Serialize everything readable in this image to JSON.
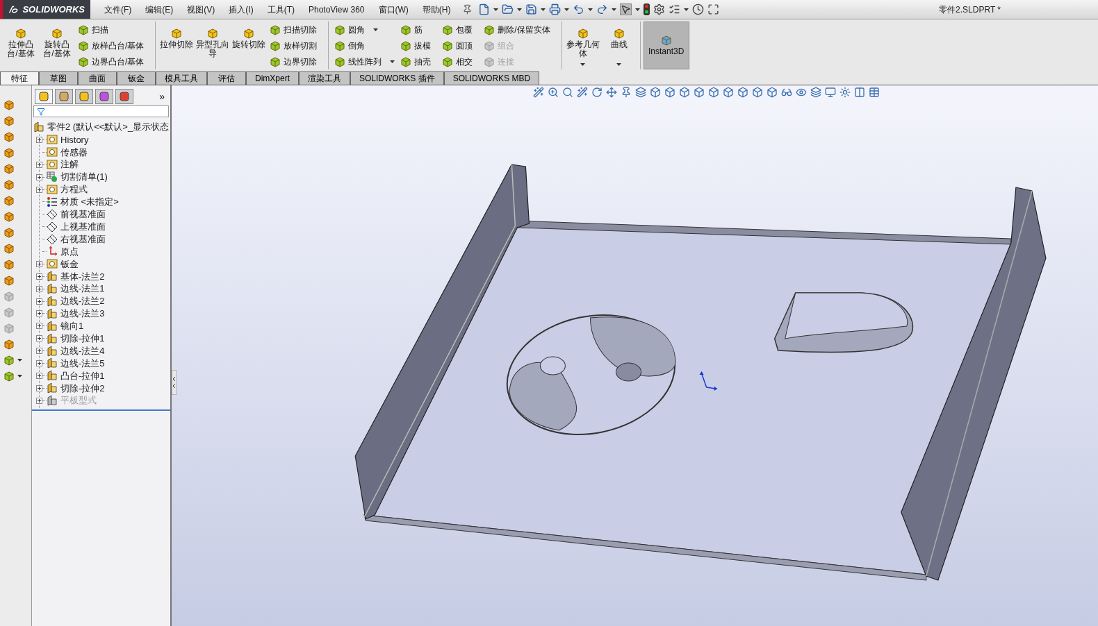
{
  "app": {
    "logo": "SOLIDWORKS",
    "title": "零件2.SLDPRT *"
  },
  "menu": [
    "文件(F)",
    "编辑(E)",
    "视图(V)",
    "插入(I)",
    "工具(T)",
    "PhotoView 360",
    "窗口(W)",
    "帮助(H)"
  ],
  "ribbon": [
    [
      {
        "kind": "large",
        "commands": [
          {
            "label": "拉伸凸台/基体",
            "disabled": false,
            "dropdown": false,
            "selected": false
          }
        ]
      },
      {
        "kind": "large",
        "commands": [
          {
            "label": "旋转凸台/基体",
            "disabled": false,
            "dropdown": false,
            "selected": false
          }
        ]
      },
      {
        "kind": "small",
        "commands": [
          {
            "label": "扫描",
            "disabled": false,
            "dropdown": false,
            "selected": false
          },
          {
            "label": "放样凸台/基体",
            "disabled": false,
            "dropdown": false,
            "selected": false
          },
          {
            "label": "边界凸台/基体",
            "disabled": false,
            "dropdown": false,
            "selected": false
          }
        ]
      }
    ],
    [
      {
        "kind": "large",
        "commands": [
          {
            "label": "拉伸切除",
            "disabled": false,
            "dropdown": false,
            "selected": false
          }
        ]
      },
      {
        "kind": "large",
        "commands": [
          {
            "label": "异型孔向导",
            "disabled": false,
            "dropdown": false,
            "selected": false
          }
        ]
      },
      {
        "kind": "large",
        "commands": [
          {
            "label": "旋转切除",
            "disabled": false,
            "dropdown": false,
            "selected": false
          }
        ]
      },
      {
        "kind": "small",
        "commands": [
          {
            "label": "扫描切除",
            "disabled": false,
            "dropdown": false,
            "selected": false
          },
          {
            "label": "放样切割",
            "disabled": false,
            "dropdown": false,
            "selected": false
          },
          {
            "label": "边界切除",
            "disabled": false,
            "dropdown": false,
            "selected": false
          }
        ]
      }
    ],
    [
      {
        "kind": "small",
        "commands": [
          {
            "label": "圆角",
            "disabled": false,
            "dropdown": true,
            "selected": false
          },
          {
            "label": "倒角",
            "disabled": false,
            "dropdown": false,
            "selected": false
          },
          {
            "label": "线性阵列",
            "disabled": false,
            "dropdown": true,
            "selected": false
          }
        ]
      },
      {
        "kind": "small",
        "commands": [
          {
            "label": "筋",
            "disabled": false,
            "dropdown": false,
            "selected": false
          },
          {
            "label": "拔模",
            "disabled": false,
            "dropdown": false,
            "selected": false
          },
          {
            "label": "抽壳",
            "disabled": false,
            "dropdown": false,
            "selected": false
          }
        ]
      },
      {
        "kind": "small",
        "commands": [
          {
            "label": "包覆",
            "disabled": false,
            "dropdown": false,
            "selected": false
          },
          {
            "label": "圆顶",
            "disabled": false,
            "dropdown": false,
            "selected": false
          },
          {
            "label": "相交",
            "disabled": false,
            "dropdown": false,
            "selected": false
          }
        ]
      },
      {
        "kind": "small",
        "commands": [
          {
            "label": "删除/保留实体",
            "disabled": false,
            "dropdown": false,
            "selected": false
          },
          {
            "label": "组合",
            "disabled": true,
            "dropdown": false,
            "selected": false
          },
          {
            "label": "连接",
            "disabled": true,
            "dropdown": false,
            "selected": false
          }
        ]
      }
    ],
    [
      {
        "kind": "large",
        "commands": [
          {
            "label": "参考几何体",
            "disabled": false,
            "dropdown": true,
            "selected": false
          }
        ]
      },
      {
        "kind": "large",
        "commands": [
          {
            "label": "曲线",
            "disabled": false,
            "dropdown": true,
            "selected": false
          }
        ]
      }
    ],
    [
      {
        "kind": "large",
        "commands": [
          {
            "label": "Instant3D",
            "disabled": false,
            "dropdown": false,
            "selected": true
          }
        ]
      }
    ]
  ],
  "tabs": [
    {
      "label": "特征",
      "selected": true
    },
    {
      "label": "草图",
      "selected": false
    },
    {
      "label": "曲面",
      "selected": false
    },
    {
      "label": "钣金",
      "selected": false
    },
    {
      "label": "模具工具",
      "selected": false
    },
    {
      "label": "评估",
      "selected": false
    },
    {
      "label": "DimXpert",
      "selected": false
    },
    {
      "label": "渲染工具",
      "selected": false
    },
    {
      "label": "SOLIDWORKS 插件",
      "selected": false
    },
    {
      "label": "SOLIDWORKS MBD",
      "selected": false
    }
  ],
  "tree": {
    "panel_tabs": [
      {
        "selected": true
      },
      {
        "selected": false
      },
      {
        "selected": false
      },
      {
        "selected": false
      },
      {
        "selected": false
      }
    ],
    "more": "»",
    "root": "零件2  (默认<<默认>_显示状态",
    "items": [
      {
        "label": "History",
        "kind": "folder",
        "expandable": true,
        "disabled": false
      },
      {
        "label": "传感器",
        "kind": "folder",
        "expandable": false,
        "disabled": false
      },
      {
        "label": "注解",
        "kind": "folder",
        "expandable": true,
        "disabled": false
      },
      {
        "label": "切割清单(1)",
        "kind": "list",
        "expandable": true,
        "disabled": false
      },
      {
        "label": "方程式",
        "kind": "folder",
        "expandable": true,
        "disabled": false
      },
      {
        "label": "材质 <未指定>",
        "kind": "material",
        "expandable": false,
        "disabled": false
      },
      {
        "label": "前视基准面",
        "kind": "plane",
        "expandable": false,
        "disabled": false
      },
      {
        "label": "上视基准面",
        "kind": "plane",
        "expandable": false,
        "disabled": false
      },
      {
        "label": "右视基准面",
        "kind": "plane",
        "expandable": false,
        "disabled": false
      },
      {
        "label": "原点",
        "kind": "origin",
        "expandable": false,
        "disabled": false
      },
      {
        "label": "钣金",
        "kind": "folder",
        "expandable": true,
        "disabled": false
      },
      {
        "label": "基体-法兰2",
        "kind": "feature",
        "expandable": true,
        "disabled": false
      },
      {
        "label": "边线-法兰1",
        "kind": "feature",
        "expandable": true,
        "disabled": false
      },
      {
        "label": "边线-法兰2",
        "kind": "feature",
        "expandable": true,
        "disabled": false
      },
      {
        "label": "边线-法兰3",
        "kind": "feature",
        "expandable": true,
        "disabled": false
      },
      {
        "label": "镜向1",
        "kind": "feature",
        "expandable": true,
        "disabled": false
      },
      {
        "label": "切除-拉伸1",
        "kind": "feature",
        "expandable": true,
        "disabled": false
      },
      {
        "label": "边线-法兰4",
        "kind": "feature",
        "expandable": true,
        "disabled": false
      },
      {
        "label": "边线-法兰5",
        "kind": "feature",
        "expandable": true,
        "disabled": false
      },
      {
        "label": "凸台-拉伸1",
        "kind": "feature",
        "expandable": true,
        "disabled": false
      },
      {
        "label": "切除-拉伸2",
        "kind": "feature",
        "expandable": true,
        "disabled": false
      },
      {
        "label": "平板型式",
        "kind": "feature",
        "expandable": true,
        "disabled": true
      }
    ]
  }
}
